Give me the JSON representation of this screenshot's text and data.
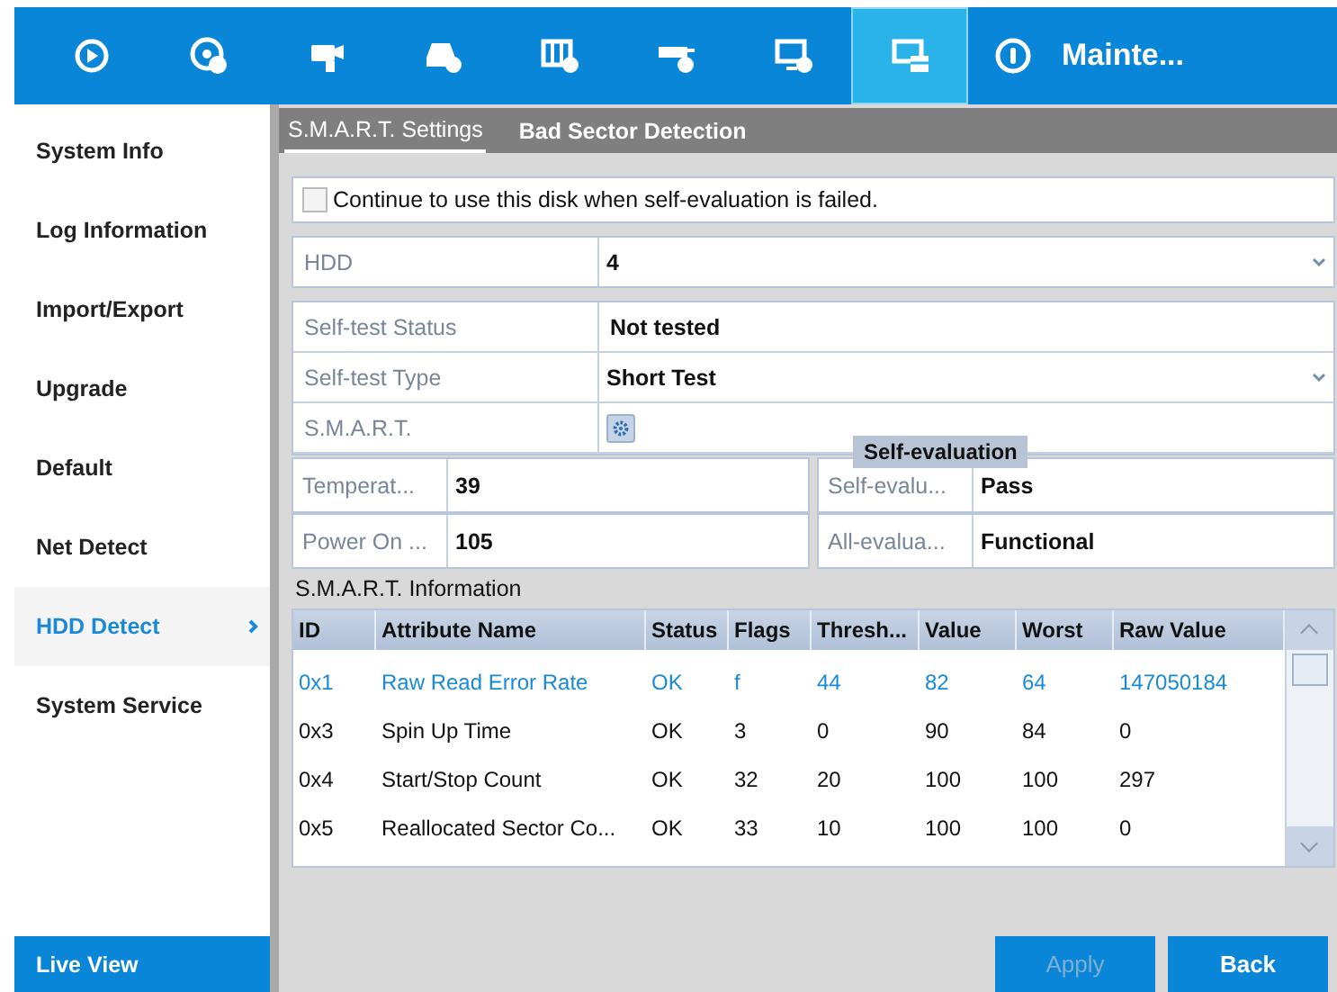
{
  "top_nav": [
    {
      "selected": false
    },
    {
      "selected": false
    },
    {
      "selected": false
    },
    {
      "selected": false
    },
    {
      "selected": false
    },
    {
      "selected": false
    },
    {
      "selected": false
    },
    {
      "selected": true
    },
    {
      "selected": false,
      "label": "Mainte..."
    }
  ],
  "sidebar": {
    "items": [
      {
        "label": "System Info",
        "selected": false
      },
      {
        "label": "Log Information",
        "selected": false
      },
      {
        "label": "Import/Export",
        "selected": false
      },
      {
        "label": "Upgrade",
        "selected": false
      },
      {
        "label": "Default",
        "selected": false
      },
      {
        "label": "Net Detect",
        "selected": false
      },
      {
        "label": "HDD Detect",
        "selected": true
      },
      {
        "label": "System Service",
        "selected": false
      }
    ],
    "live_view": "Live View"
  },
  "tabs": [
    {
      "label": "S.M.A.R.T. Settings",
      "selected": true
    },
    {
      "label": "Bad Sector Detection",
      "selected": false
    }
  ],
  "continue_option": {
    "label": "Continue to use this disk when self-evaluation is failed.",
    "checked": false
  },
  "hdd": {
    "label": "HDD",
    "value": "4"
  },
  "settings": [
    {
      "label": "Self-test Status",
      "value": "Not tested",
      "kind": "text"
    },
    {
      "label": "Self-test Type",
      "value": "Short Test",
      "kind": "dropdown"
    },
    {
      "label": "S.M.A.R.T.",
      "kind": "gear"
    }
  ],
  "tooltip": "Self-evaluation",
  "summary": [
    {
      "label": "Temperat...",
      "value": "39"
    },
    {
      "label": "Self-evalu...",
      "value": "Pass"
    },
    {
      "label": "Power On ...",
      "value": "105"
    },
    {
      "label": "All-evalua...",
      "value": "Functional"
    }
  ],
  "smart_info": {
    "title": "S.M.A.R.T. Information",
    "columns": [
      "ID",
      "Attribute Name",
      "Status",
      "Flags",
      "Thresh...",
      "Value",
      "Worst",
      "Raw Value"
    ],
    "rows": [
      {
        "selected": true,
        "cells": [
          "0x1",
          "Raw Read Error Rate",
          "OK",
          "f",
          "44",
          "82",
          "64",
          "147050184"
        ]
      },
      {
        "selected": false,
        "cells": [
          "0x3",
          "Spin Up Time",
          "OK",
          "3",
          "0",
          "90",
          "84",
          "0"
        ]
      },
      {
        "selected": false,
        "cells": [
          "0x4",
          "Start/Stop Count",
          "OK",
          "32",
          "20",
          "100",
          "100",
          "297"
        ]
      },
      {
        "selected": false,
        "cells": [
          "0x5",
          "Reallocated Sector Co...",
          "OK",
          "33",
          "10",
          "100",
          "100",
          "0"
        ]
      }
    ]
  },
  "buttons": [
    {
      "label": "Apply",
      "disabled": true
    },
    {
      "label": "Back",
      "disabled": false
    }
  ]
}
